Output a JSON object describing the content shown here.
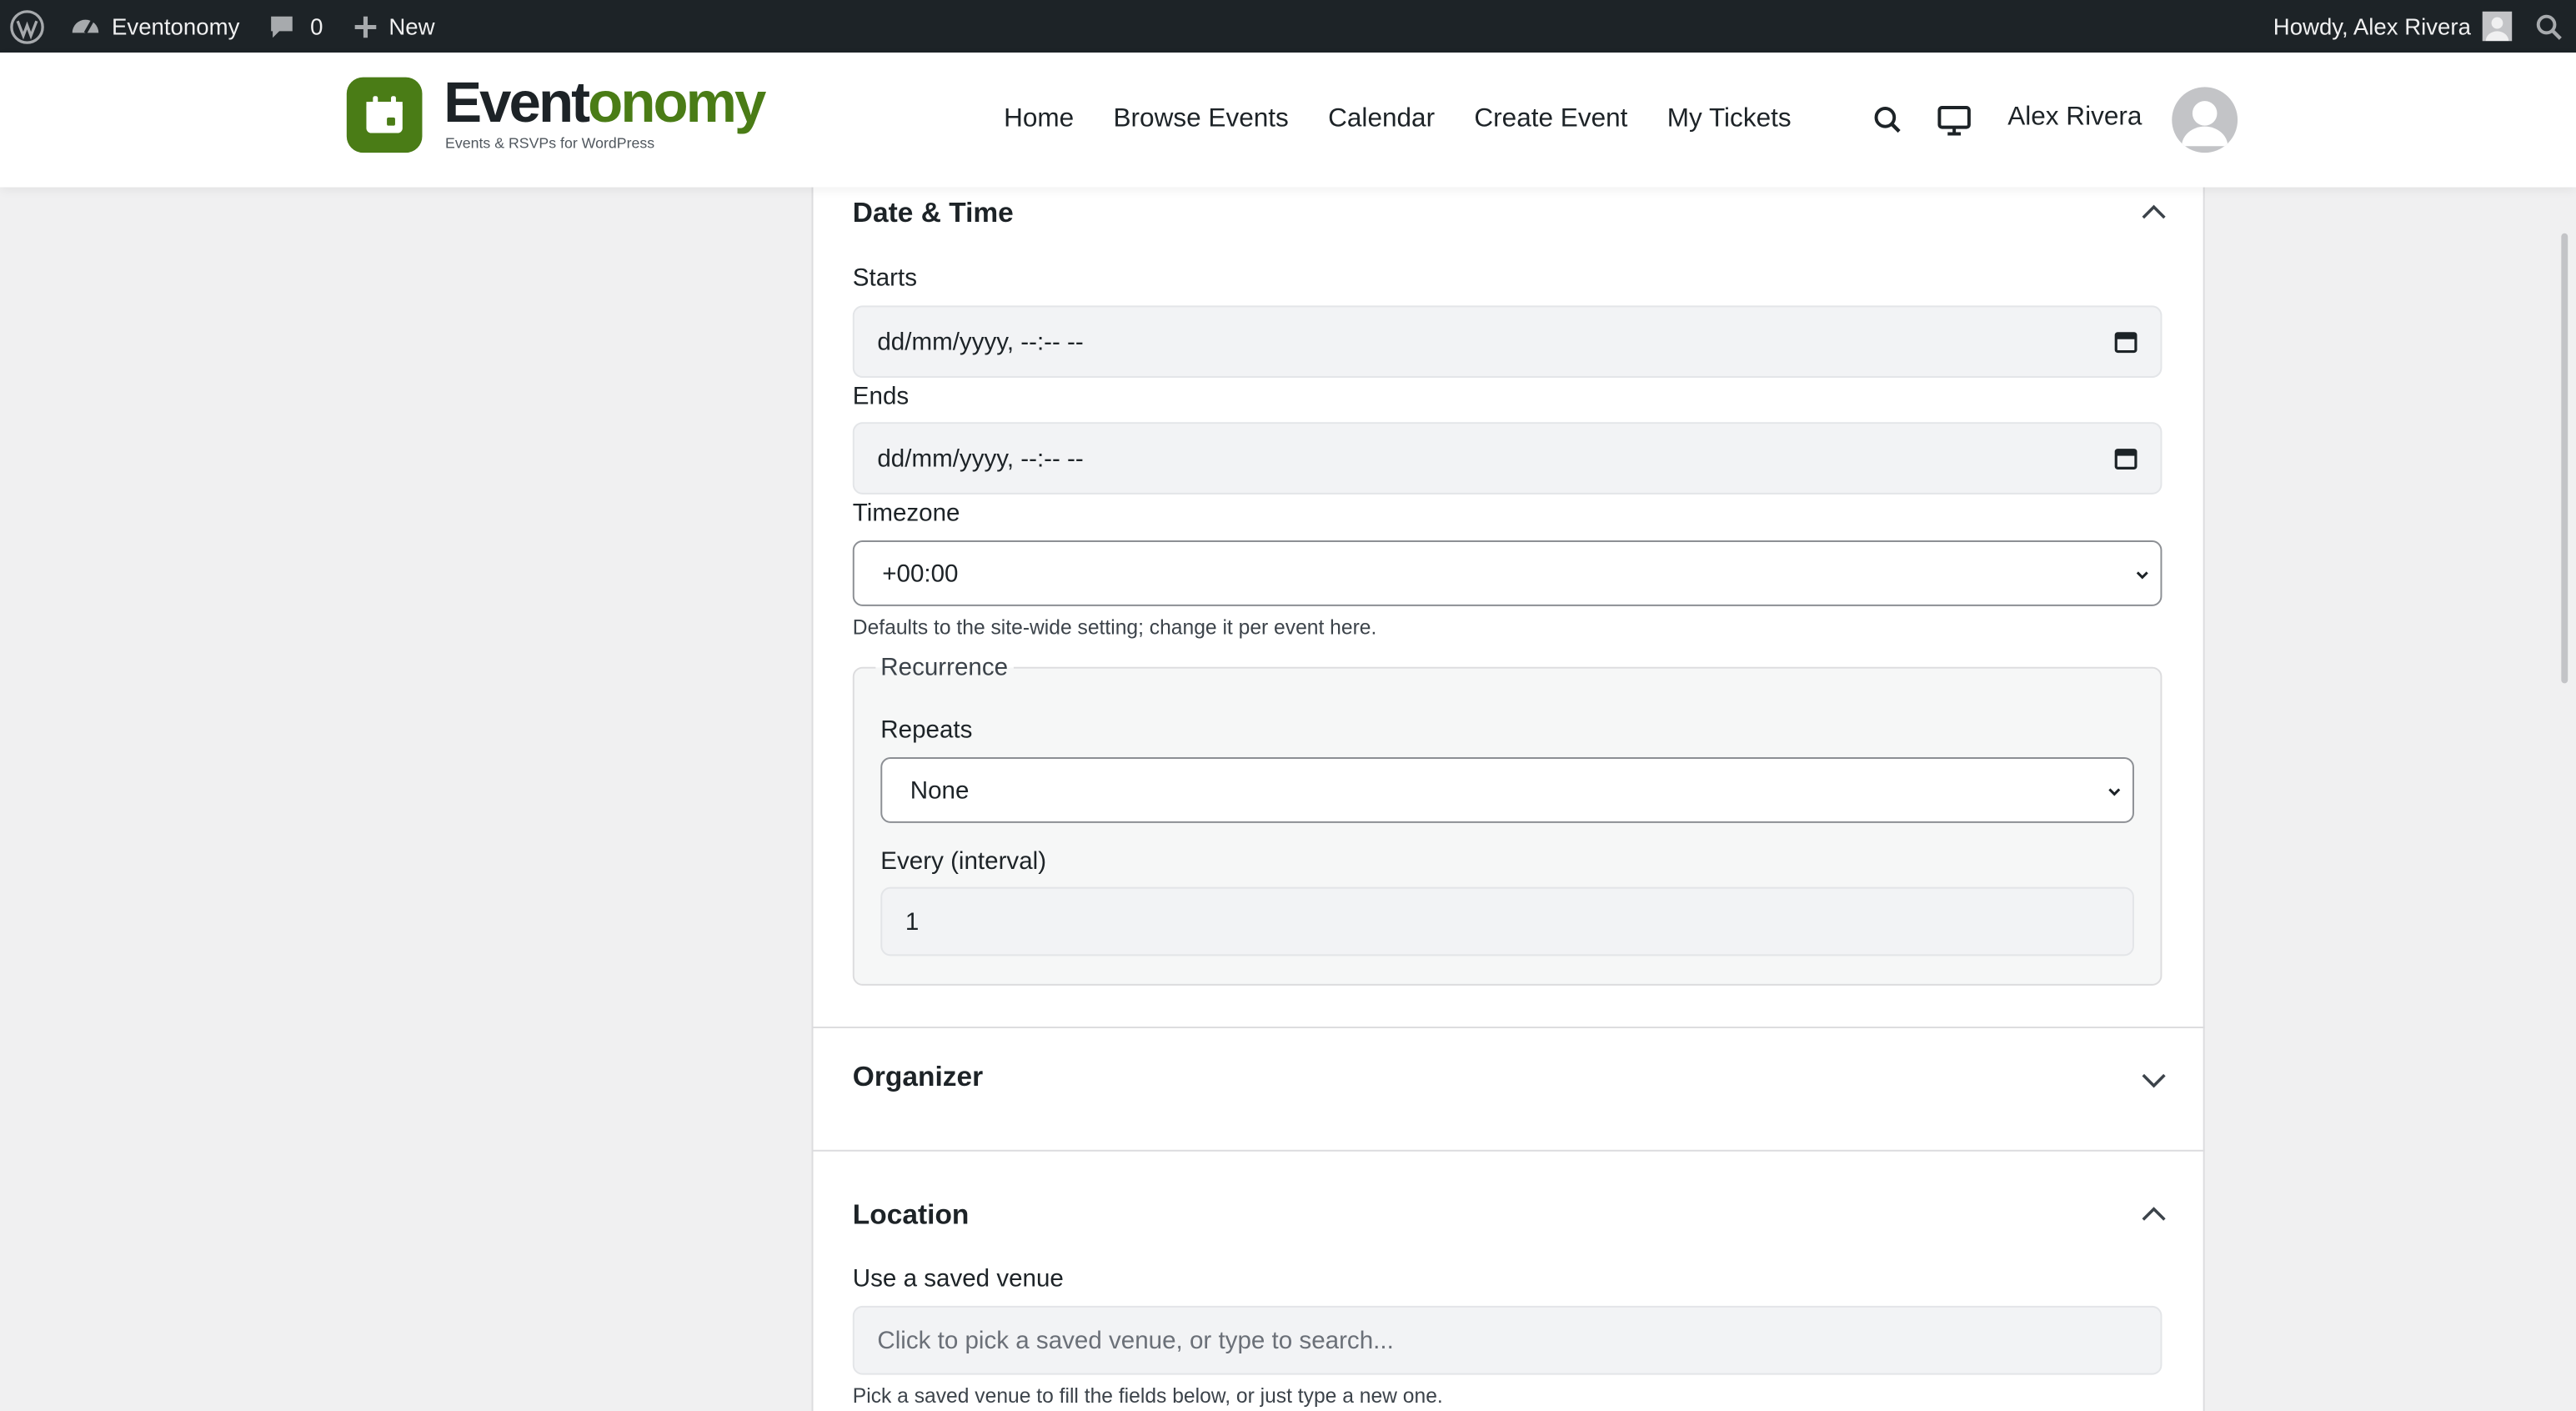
{
  "adminbar": {
    "site_name": "Eventonomy",
    "comments_count": "0",
    "new_label": "New",
    "howdy": "Howdy, Alex Rivera"
  },
  "header": {
    "logo_part1": "Event",
    "logo_part2": "onomy",
    "tagline": "Events & RSVPs for WordPress",
    "nav": [
      "Home",
      "Browse Events",
      "Calendar",
      "Create Event",
      "My Tickets"
    ],
    "user_name": "Alex Rivera"
  },
  "date_time": {
    "title": "Date & Time",
    "starts_label": "Starts",
    "starts_value": "dd/mm/yyyy, --:-- --",
    "ends_label": "Ends",
    "ends_value": "dd/mm/yyyy, --:-- --",
    "timezone_label": "Timezone",
    "timezone_value": "+00:00",
    "timezone_help": "Defaults to the site-wide setting; change it per event here.",
    "recurrence": {
      "legend": "Recurrence",
      "repeats_label": "Repeats",
      "repeats_value": "None",
      "interval_label": "Every (interval)",
      "interval_value": "1"
    }
  },
  "organizer": {
    "title": "Organizer"
  },
  "location": {
    "title": "Location",
    "venue_label": "Use a saved venue",
    "venue_placeholder": "Click to pick a saved venue, or type to search...",
    "venue_help": "Pick a saved venue to fill the fields below, or just type a new one."
  },
  "colors": {
    "brand": "#4a7c16",
    "adminbar_bg": "#1d2327"
  }
}
